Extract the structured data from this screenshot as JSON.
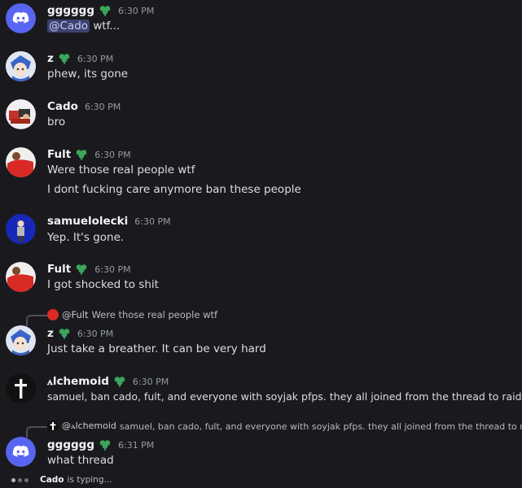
{
  "messages": [
    {
      "id": "m1",
      "author": "gggggg",
      "time": "6:30 PM",
      "mention": "@Cado",
      "text": " wtf..."
    },
    {
      "id": "m2",
      "author": "z",
      "time": "6:30 PM",
      "text": "phew, its gone"
    },
    {
      "id": "m3",
      "author": "Cado",
      "time": "6:30 PM",
      "text": "bro"
    },
    {
      "id": "m4",
      "author": "Fult",
      "time": "6:30 PM",
      "text": "Were those real people wtf",
      "text2": "I dont fucking care anymore ban these people"
    },
    {
      "id": "m5",
      "author": "samuelolecki",
      "time": "6:30 PM",
      "text": "Yep. It's gone."
    },
    {
      "id": "m6",
      "author": "Fult",
      "time": "6:30 PM",
      "text": "I got shocked to shit"
    },
    {
      "id": "m7",
      "author": "z",
      "time": "6:30 PM",
      "reply_name": "@Fult",
      "reply_text": "Were those real people wtf",
      "text": "Just take a breather. It can be very hard"
    },
    {
      "id": "m8",
      "author": "ꭺlchemoid",
      "time": "6:30 PM",
      "text": "samuel, ban cado, fult, and everyone with soyjak pfps. they all joined from the thread to raid."
    },
    {
      "id": "m9",
      "author": "gggggg",
      "time": "6:31 PM",
      "reply_name": "@ꭺlchemoid",
      "reply_text": "samuel, ban cado, fult, and everyone with soyjak pfps. they all joined from the thread to raid.",
      "text": "what thread"
    }
  ],
  "typing": {
    "user": "Cado",
    "suffix": "is typing..."
  },
  "colors": {
    "discord_blurple": "#5865f2",
    "badge_green": "#3ba55c",
    "background": "#1a1a1e"
  }
}
